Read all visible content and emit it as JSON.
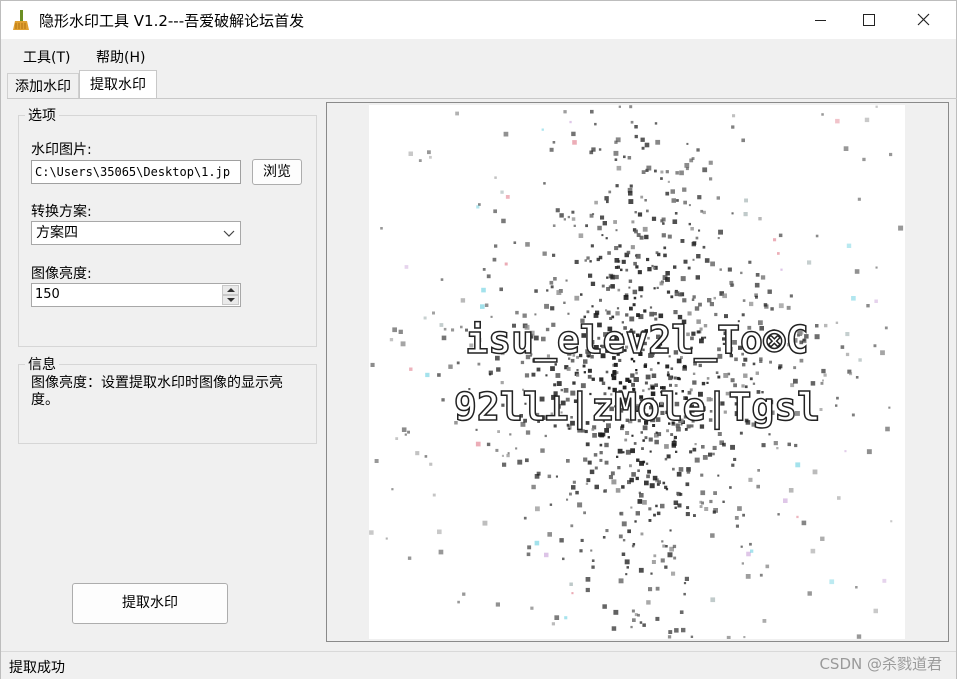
{
  "window": {
    "title": "隐形水印工具 V1.2---吾爱破解论坛首发",
    "app_icon": "broom-icon",
    "controls": {
      "minimize": "minimize-icon",
      "maximize": "maximize-icon",
      "close": "close-icon"
    }
  },
  "menu": {
    "items": [
      {
        "label": "工具(T)"
      },
      {
        "label": "帮助(H)"
      }
    ]
  },
  "tabs": [
    {
      "label": "添加水印",
      "active": false
    },
    {
      "label": "提取水印",
      "active": true
    }
  ],
  "options": {
    "group_title": "选项",
    "watermark_image_label": "水印图片:",
    "watermark_image_path": "C:\\Users\\35065\\Desktop\\1.jp",
    "browse_label": "浏览",
    "scheme_label": "转换方案:",
    "scheme_value": "方案四",
    "brightness_label": "图像亮度:",
    "brightness_value": "150"
  },
  "info": {
    "group_title": "信息",
    "text": "图像亮度：设置提取水印时图像的显示亮度。"
  },
  "extract_button_label": "提取水印",
  "preview": {
    "line1": "isu_elev2l_To⊗C",
    "line2": "92ll⊥|zMole|Tgsl"
  },
  "status": {
    "text": "提取成功"
  },
  "overlay_watermark": "CSDN @杀戮道君",
  "colors": {
    "background": "#f0f0f0",
    "title_bar": "#ffffff",
    "preview_canvas": "#ffffff",
    "noise": "#1a1a1a"
  }
}
